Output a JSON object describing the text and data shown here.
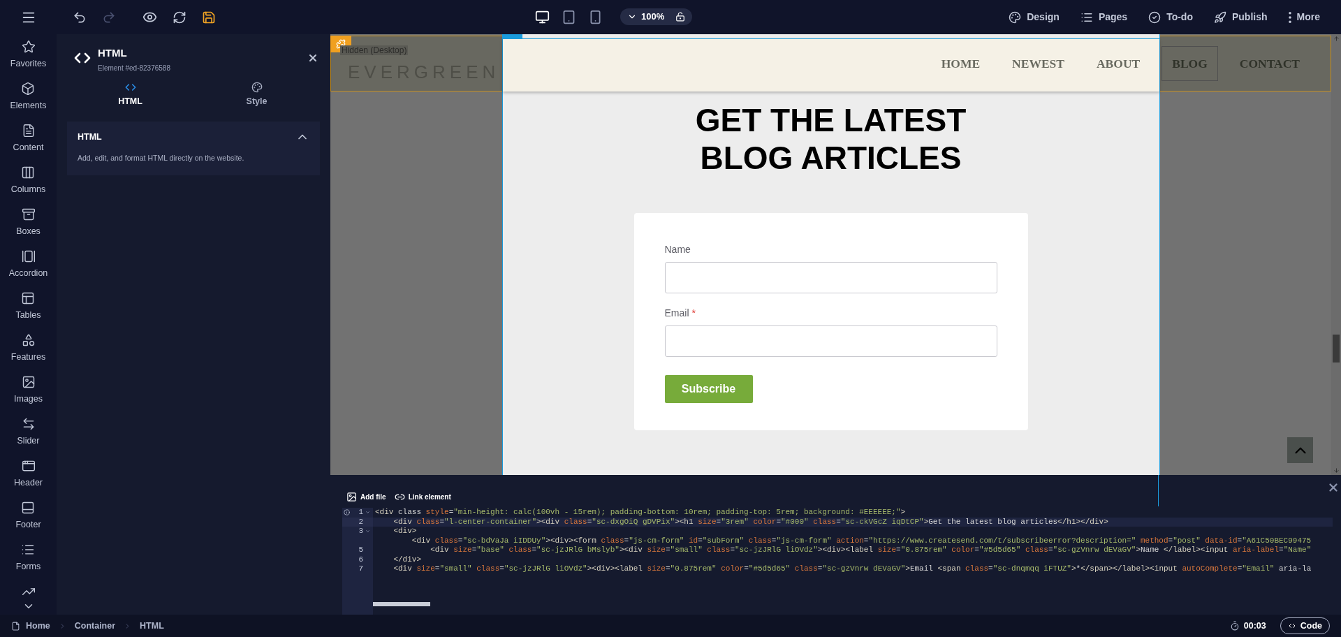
{
  "toolbar": {
    "devices": [
      {
        "kind": "desktop",
        "selected": true
      },
      {
        "kind": "tablet",
        "selected": false
      },
      {
        "kind": "phone",
        "selected": false
      }
    ],
    "zoom": "100%",
    "actions": [
      {
        "kind": "design",
        "label": "Design"
      },
      {
        "kind": "pages",
        "label": "Pages"
      },
      {
        "kind": "todo",
        "label": "To-do"
      },
      {
        "kind": "publish",
        "label": "Publish"
      },
      {
        "kind": "more",
        "label": "More"
      }
    ]
  },
  "sidebar": {
    "items": [
      {
        "kind": "star",
        "label": "Favorites"
      },
      {
        "kind": "box",
        "label": "Elements"
      },
      {
        "kind": "file",
        "label": "Content"
      },
      {
        "kind": "columns",
        "label": "Columns"
      },
      {
        "kind": "archive",
        "label": "Boxes"
      },
      {
        "kind": "accordion",
        "label": "Accordion"
      },
      {
        "kind": "table",
        "label": "Tables"
      },
      {
        "kind": "features",
        "label": "Features"
      },
      {
        "kind": "image",
        "label": "Images"
      },
      {
        "kind": "slider",
        "label": "Slider"
      },
      {
        "kind": "header",
        "label": "Header"
      },
      {
        "kind": "footer",
        "label": "Footer"
      },
      {
        "kind": "forms",
        "label": "Forms"
      },
      {
        "kind": "trend"
      }
    ]
  },
  "panel": {
    "title": "HTML",
    "subtitle": "Element #ed-82376588",
    "tabs": [
      {
        "kind": "code",
        "label": "HTML",
        "selected": true
      },
      {
        "kind": "palette",
        "label": "Style",
        "selected": false
      }
    ],
    "section": {
      "title": "HTML",
      "expanded": true,
      "description": "Add, edit, and format HTML directly on the website."
    }
  },
  "canvas": {
    "hidden_label": "Hidden (Desktop)",
    "logo": "EVERGREEN",
    "nav": [
      {
        "label": "HOME",
        "selected": false
      },
      {
        "label": "NEWEST",
        "selected": false
      },
      {
        "label": "ABOUT",
        "selected": false
      },
      {
        "label": "BLOG",
        "selected": true
      },
      {
        "label": "CONTACT",
        "selected": false
      }
    ],
    "heading_lines": [
      "GET THE LATEST",
      "BLOG ARTICLES"
    ],
    "form": {
      "fields": [
        {
          "label": "Name"
        },
        {
          "label": "Email",
          "required_mark": "*"
        }
      ],
      "button": "Subscribe"
    }
  },
  "code_editor": {
    "tools": [
      {
        "kind": "image",
        "label": "Add file"
      },
      {
        "kind": "link",
        "label": "Link element"
      }
    ],
    "lines": [
      {
        "number": "1",
        "fold": true,
        "active": false,
        "text": "<div class style=\"min-height: calc(100vh - 15rem); padding-bottom: 10rem; padding-top: 5rem; background: #EEEEEE;\">"
      },
      {
        "number": "2",
        "fold": false,
        "active": true,
        "text": "    <div class=\"l-center-container\"><div class=\"sc-dxgOiQ gDVPix\"><h1 size=\"3rem\" color=\"#000\" class=\"sc-ckVGcZ iqDtCP\">Get the latest blog articles</h1></div>"
      },
      {
        "number": "3",
        "fold": true,
        "active": false,
        "text": "    <div>"
      },
      {
        "fold": false,
        "active": false,
        "text": "        <div class=\"sc-bdVaJa iIDDUy\"><div><form class=\"js-cm-form\" id=\"subForm\" class=\"js-cm-form\" action=\"https://www.createsend.com/t/subscribeerror?description=\" method=\"post\" data-id=\"A61C50BEC99475"
      },
      {
        "number": "5",
        "fold": false,
        "active": false,
        "text": "            <div size=\"base\" class=\"sc-jzJRlG bMslyb\"><div size=\"small\" class=\"sc-jzJRlG liOVdz\"><div><label size=\"0.875rem\" color=\"#5d5d65\" class=\"sc-gzVnrw dEVaGV\">Name </label><input aria-label=\"Name\""
      },
      {
        "number": "6",
        "fold": false,
        "active": false,
        "text": "    </div>"
      },
      {
        "number": "7",
        "fold": false,
        "active": false,
        "text": "    <div size=\"small\" class=\"sc-jzJRlG liOVdz\"><div><label size=\"0.875rem\" color=\"#5d5d65\" class=\"sc-gzVnrw dEVaGV\">Email <span class=\"sc-dnqmqq iFTUZ\">*</span></label><input autoComplete=\"Email\" aria-la"
      }
    ]
  },
  "status_bar": {
    "breadcrumbs": [
      "Home",
      "Container",
      "HTML"
    ],
    "timer": "00:03",
    "code_button": "Code"
  }
}
